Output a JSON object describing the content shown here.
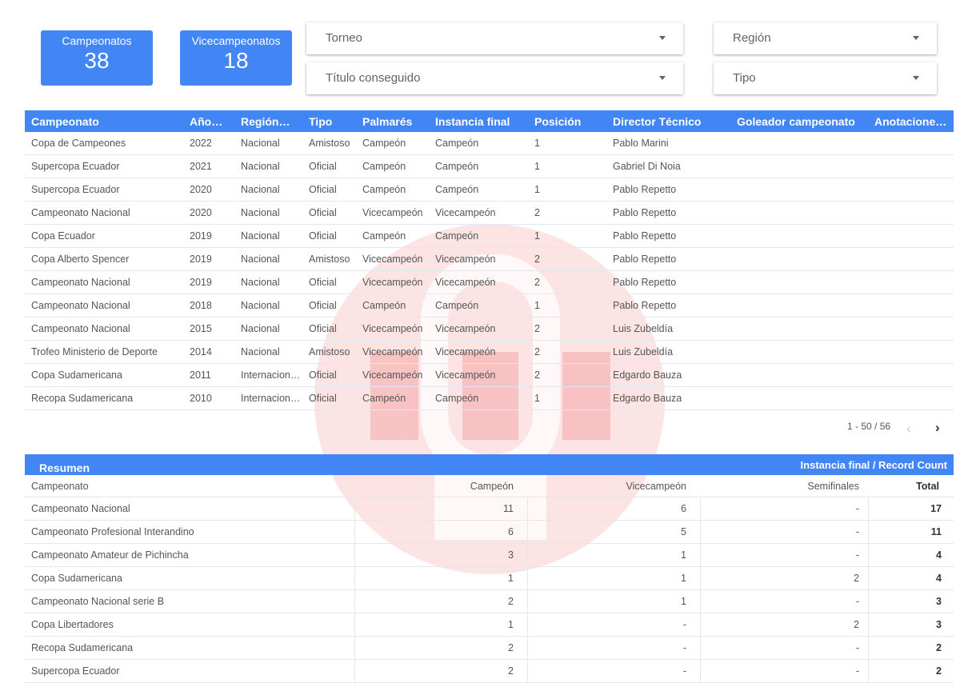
{
  "kpis": [
    {
      "label": "Campeonatos",
      "value": "38"
    },
    {
      "label": "Vicecampeonatos",
      "value": "18"
    }
  ],
  "filters": {
    "torneo": "Torneo",
    "titulo": "Título conseguido",
    "region": "Región",
    "tipo": "Tipo"
  },
  "table": {
    "headers": [
      "Campeonato",
      "Año…",
      "Región…",
      "Tipo",
      "Palmarés",
      "Instancia final",
      "Posición",
      "Director Técnico",
      "Goleador campeonato",
      "Anotaciones…"
    ],
    "rows": [
      [
        "Copa de Campeones",
        "2022",
        "Nacional",
        "Amistoso",
        "Campeón",
        "Campeón",
        "1",
        "Pablo Marini"
      ],
      [
        "Supercopa Ecuador",
        "2021",
        "Nacional",
        "Oficial",
        "Campeón",
        "Campeón",
        "1",
        "Gabriel Di Noia"
      ],
      [
        "Supercopa Ecuador",
        "2020",
        "Nacional",
        "Oficial",
        "Campeón",
        "Campeón",
        "1",
        "Pablo Repetto"
      ],
      [
        "Campeonato Nacional",
        "2020",
        "Nacional",
        "Oficial",
        "Vicecampeón",
        "Vicecampeón",
        "2",
        "Pablo Repetto"
      ],
      [
        "Copa Ecuador",
        "2019",
        "Nacional",
        "Oficial",
        "Campeón",
        "Campeón",
        "1",
        "Pablo Repetto"
      ],
      [
        "Copa Alberto Spencer",
        "2019",
        "Nacional",
        "Amistoso",
        "Vicecampeón",
        "Vicecampeón",
        "2",
        "Pablo Repetto"
      ],
      [
        "Campeonato Nacional",
        "2019",
        "Nacional",
        "Oficial",
        "Vicecampeón",
        "Vicecampeón",
        "2",
        "Pablo Repetto"
      ],
      [
        "Campeonato Nacional",
        "2018",
        "Nacional",
        "Oficial",
        "Campeón",
        "Campeón",
        "1",
        "Pablo Repetto"
      ],
      [
        "Campeonato Nacional",
        "2015",
        "Nacional",
        "Oficial",
        "Vicecampeón",
        "Vicecampeón",
        "2",
        "Luis Zubeldía"
      ],
      [
        "Trofeo Ministerio de Deporte",
        "2014",
        "Nacional",
        "Amistoso",
        "Vicecampeón",
        "Vicecampeón",
        "2",
        "Luis Zubeldía"
      ],
      [
        "Copa Sudamericana",
        "2011",
        "Internacion…",
        "Oficial",
        "Vicecampeón",
        "Vicecampeón",
        "2",
        "Edgardo Bauza"
      ],
      [
        "Recopa Sudamericana",
        "2010",
        "Internacion…",
        "Oficial",
        "Campeón",
        "Campeón",
        "1",
        "Edgardo Bauza"
      ]
    ]
  },
  "pagination": {
    "range": "1 - 50 / 56",
    "prev": "‹",
    "next": "›"
  },
  "pivot": {
    "title": "Resumen",
    "right_title": "Instancia final / Record Count",
    "columns": [
      "Campeonato",
      "Campeón",
      "Vicecampeón",
      "Semifinales",
      "Total"
    ],
    "rows": [
      [
        "Campeonato Nacional",
        "11",
        "6",
        "-",
        "17"
      ],
      [
        "Campeonato Profesional Interandino",
        "6",
        "5",
        "-",
        "11"
      ],
      [
        "Campeonato Amateur de Pichincha",
        "3",
        "1",
        "-",
        "4"
      ],
      [
        "Copa Sudamericana",
        "1",
        "1",
        "2",
        "4"
      ],
      [
        "Campeonato Nacional serie B",
        "2",
        "1",
        "-",
        "3"
      ],
      [
        "Copa Libertadores",
        "1",
        "-",
        "2",
        "3"
      ],
      [
        "Recopa Sudamericana",
        "2",
        "-",
        "-",
        "2"
      ],
      [
        "Supercopa Ecuador",
        "2",
        "-",
        "-",
        "2"
      ]
    ]
  },
  "watermark": {
    "text": "LDU",
    "color": "#e8302f"
  }
}
